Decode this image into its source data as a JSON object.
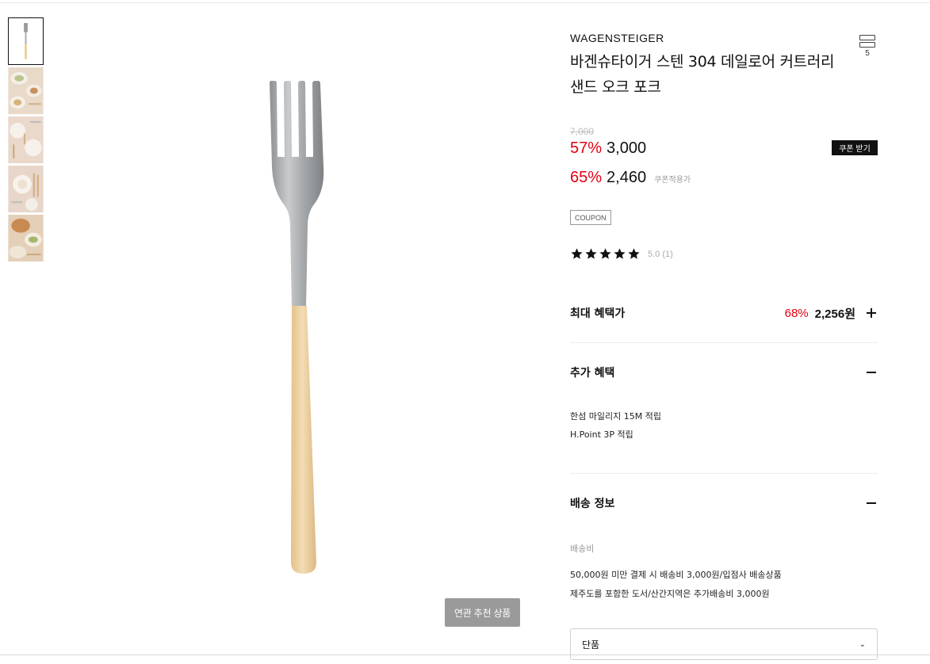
{
  "product": {
    "brand": "WAGENSTEIGER",
    "title": "바겐슈타이거 스텐 304 데일로어 커트러리 샌드 오크 포크",
    "share_count": "5",
    "original_price": "7,000",
    "sale_percent": "57%",
    "sale_price": "3,000",
    "coupon_percent": "65%",
    "coupon_price": "2,460",
    "coupon_price_label": "쿠폰적용가",
    "coupon_button": "쿠폰 받기",
    "coupon_tag": "COUPON",
    "rating": 5.0,
    "rating_text": "5.0 (1)"
  },
  "max_benefit": {
    "label": "최대 혜택가",
    "percent": "68%",
    "price": "2,256원"
  },
  "extra_benefit": {
    "label": "추가 혜택",
    "items": [
      "한섬 마일리지 15M 적립",
      "H.Point 3P 적립"
    ]
  },
  "shipping": {
    "label": "배송 정보",
    "fee_label": "배송비",
    "lines": [
      "50,000원 미만 결제 시 배송비 3,000원/입점사 배송상품",
      "제주도를 포함한 도서/산간지역은 추가배송비 3,000원"
    ]
  },
  "option_select": {
    "value": "단품"
  },
  "related_button": "연관 추천 상품",
  "icons": {
    "share": "share-icon",
    "star": "star-icon",
    "chevron": "chevron-down-icon",
    "plus": "plus-icon",
    "minus": "minus-icon"
  },
  "colors": {
    "sale_red": "#e50012",
    "handle": "#edcf9d",
    "button_gray": "#9a9a9a"
  }
}
